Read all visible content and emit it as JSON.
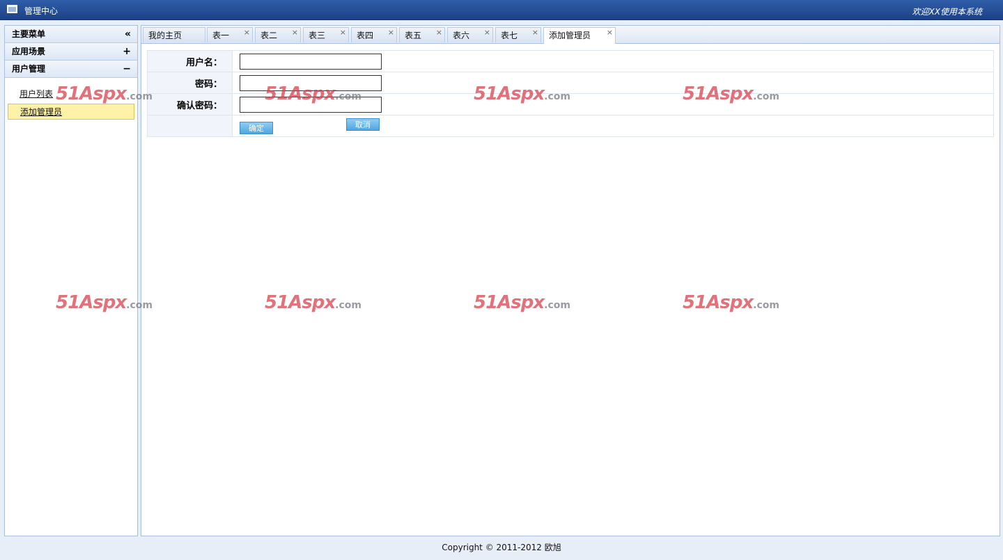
{
  "header": {
    "title": "管理中心",
    "welcome": "欢迎XX使用本系统"
  },
  "sidebar": {
    "main_menu": "主要菜单",
    "collapse_icon": "«",
    "sections": [
      {
        "label": "应用场景",
        "tool": "+"
      },
      {
        "label": "用户管理",
        "tool": "−"
      }
    ],
    "items": [
      {
        "label": "用户列表"
      },
      {
        "label": "添加管理员"
      }
    ]
  },
  "tabs": [
    {
      "label": "我的主页",
      "closable": false
    },
    {
      "label": "表一",
      "closable": true
    },
    {
      "label": "表二",
      "closable": true
    },
    {
      "label": "表三",
      "closable": true
    },
    {
      "label": "表四",
      "closable": true
    },
    {
      "label": "表五",
      "closable": true
    },
    {
      "label": "表六",
      "closable": true
    },
    {
      "label": "表七",
      "closable": true
    },
    {
      "label": "添加管理员",
      "closable": true,
      "active": true
    }
  ],
  "close_glyph": "×",
  "form": {
    "username_label": "用户名：",
    "password_label": "密码：",
    "confirm_label": "确认密码：",
    "username_value": "",
    "password_value": "",
    "confirm_value": "",
    "ok_label": "确定",
    "cancel_label": "取消"
  },
  "footer": {
    "copyright": "Copyright © 2011-2012 欧旭"
  },
  "watermark": {
    "brand": "51Aspx",
    "suffix": ".com"
  },
  "colors": {
    "header_blue": "#1c4288",
    "active_item": "#fdf2a8",
    "button_blue": "#4fa6e0"
  }
}
